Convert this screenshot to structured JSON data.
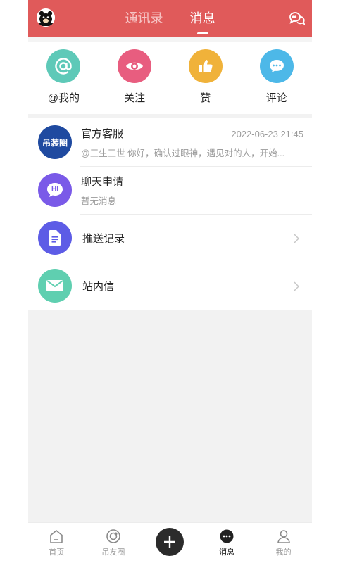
{
  "header": {
    "tabs": [
      {
        "label": "通讯录",
        "active": false
      },
      {
        "label": "消息",
        "active": true
      }
    ],
    "accent_color": "#e05a5a"
  },
  "quick_actions": [
    {
      "label": "@我的",
      "icon": "at-icon",
      "color": "#5ec9b8"
    },
    {
      "label": "关注",
      "icon": "eye-icon",
      "color": "#e85d7f"
    },
    {
      "label": "赞",
      "icon": "thumbs-up-icon",
      "color": "#f0b23a"
    },
    {
      "label": "评论",
      "icon": "comment-icon",
      "color": "#4db8e8"
    }
  ],
  "list": [
    {
      "title": "官方客服",
      "subtitle": "@三生三世 你好，确认过眼神，遇见对的人，开始...",
      "time": "2022-06-23 21:45",
      "avatar_text": "吊装圈"
    },
    {
      "title": "聊天申请",
      "subtitle": "暂无消息",
      "avatar_text": "HI"
    },
    {
      "title": "推送记录"
    },
    {
      "title": "站内信"
    }
  ],
  "bottom_nav": [
    {
      "label": "首页",
      "icon": "home-icon"
    },
    {
      "label": "吊友圈",
      "icon": "circle-icon"
    },
    {
      "label": "",
      "icon": "plus-icon"
    },
    {
      "label": "消息",
      "icon": "message-icon",
      "active": true
    },
    {
      "label": "我的",
      "icon": "user-icon"
    }
  ]
}
